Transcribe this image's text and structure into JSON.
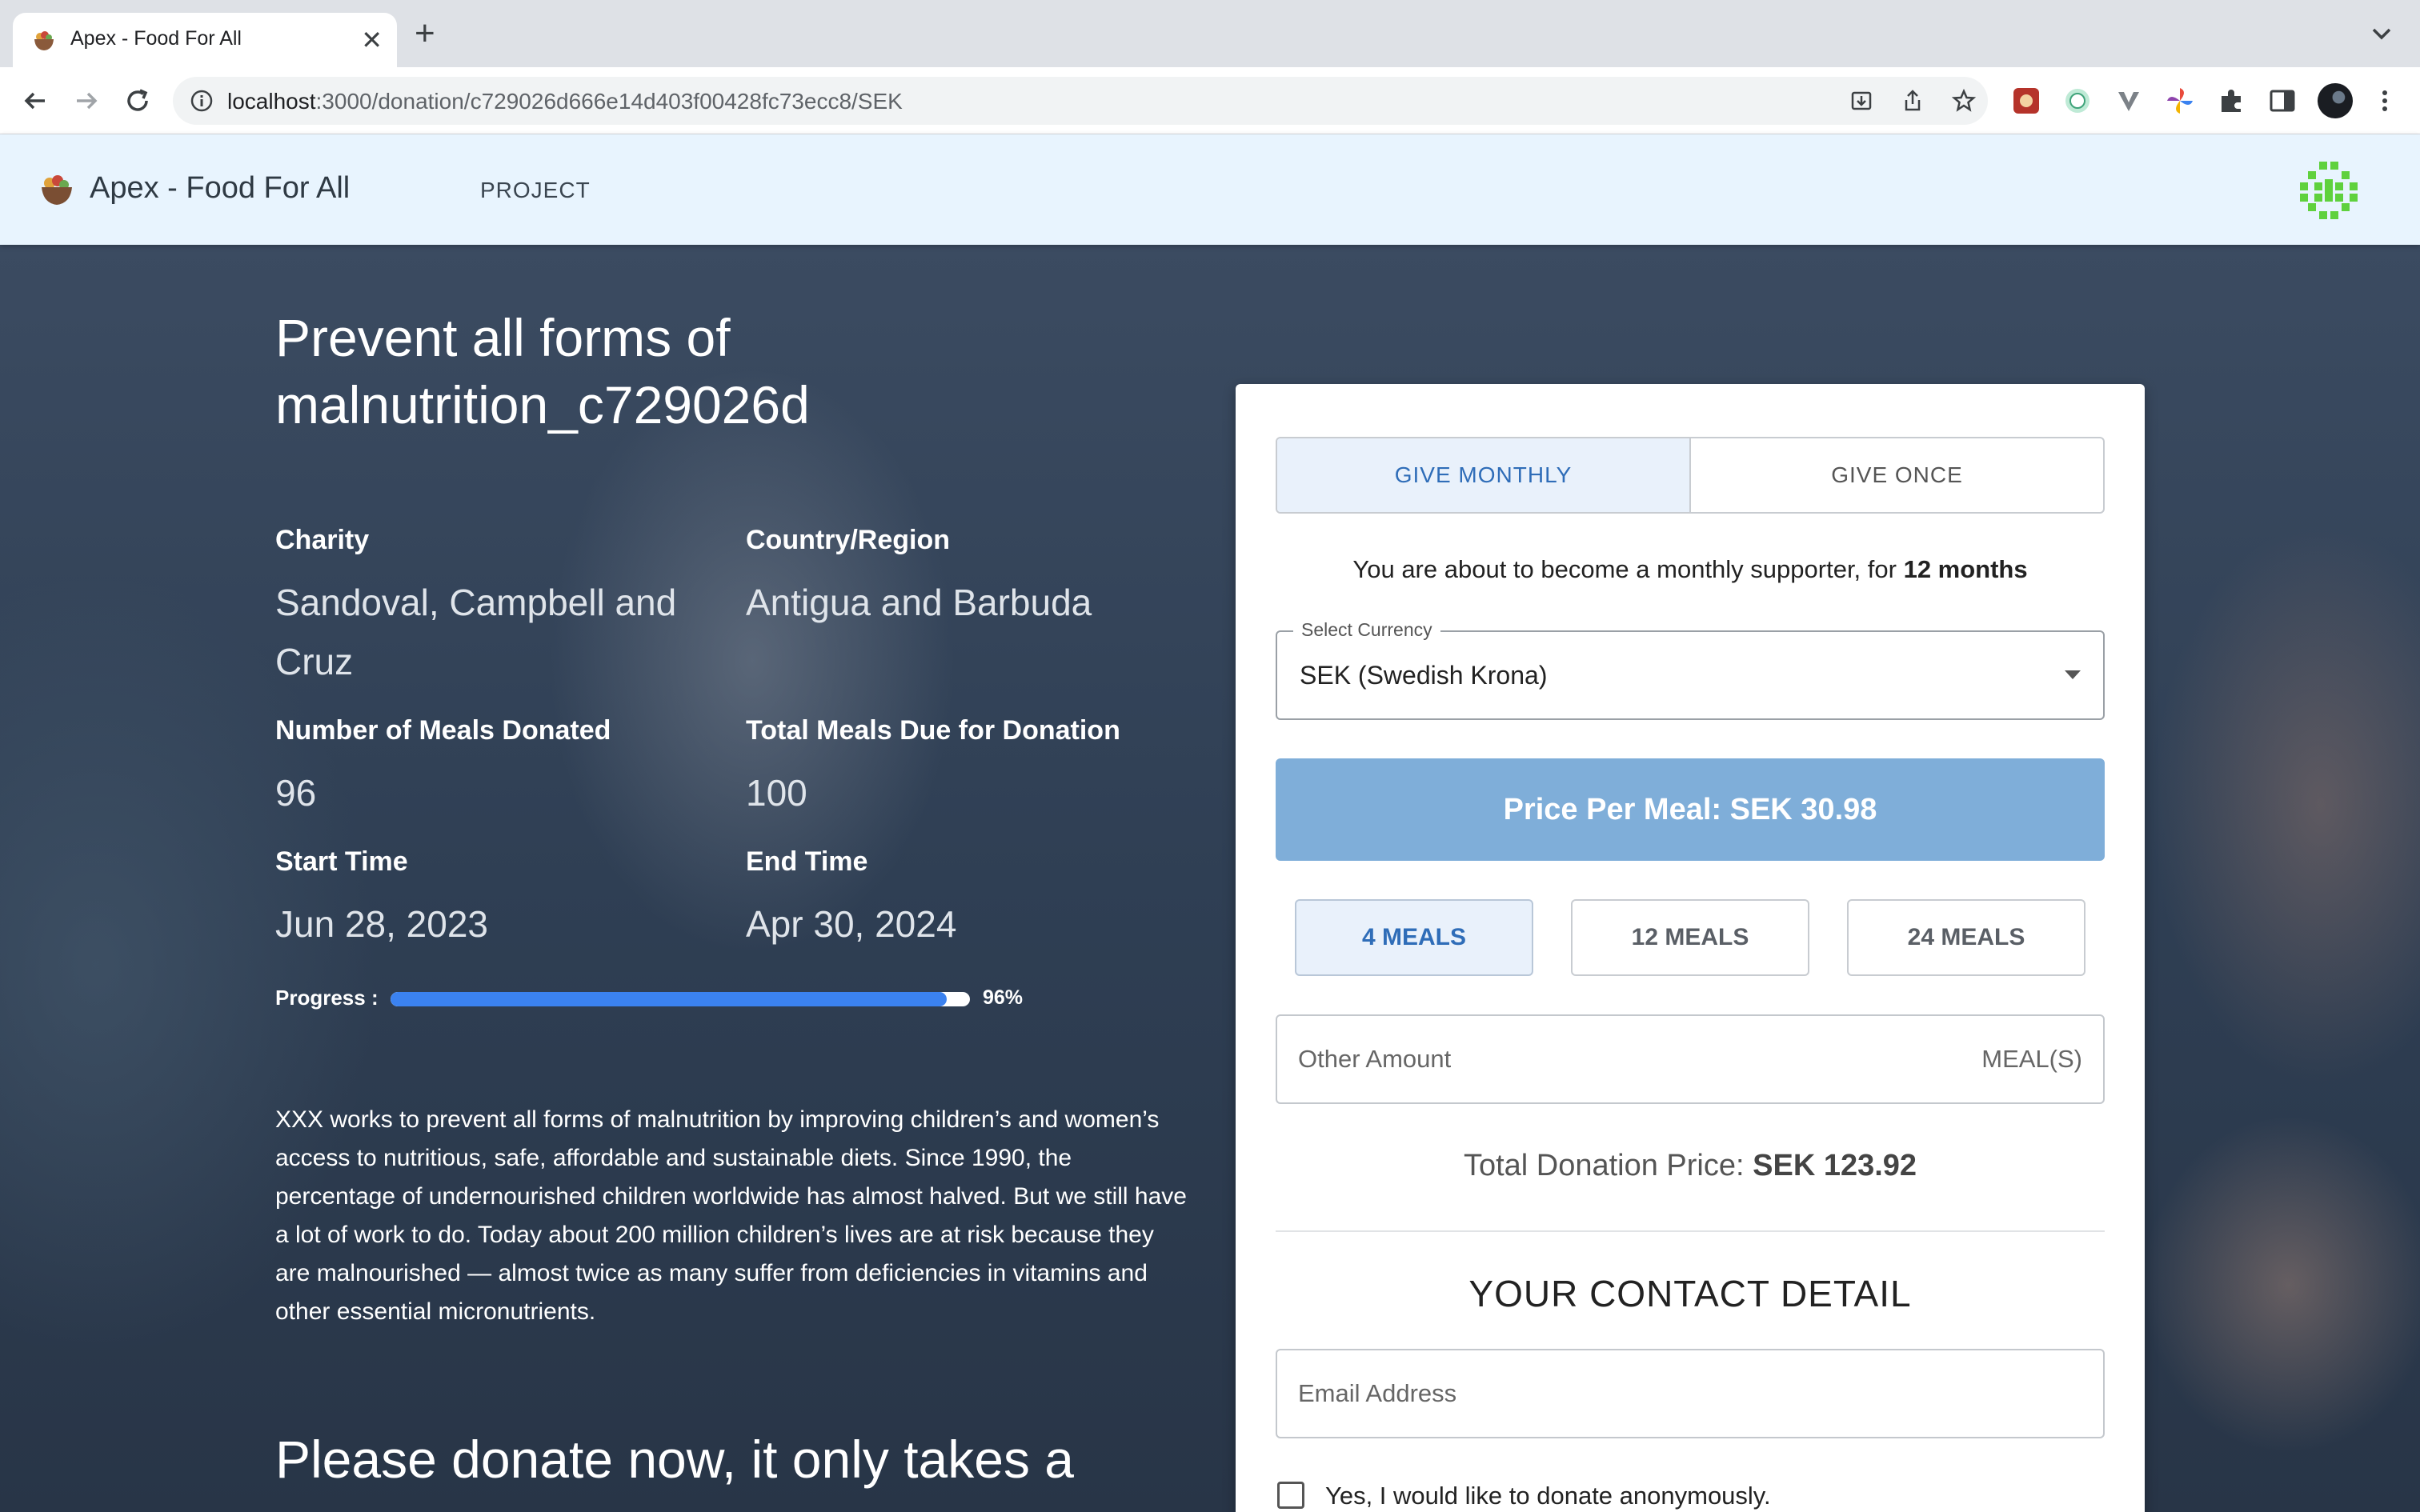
{
  "browser": {
    "tab_title": "Apex - Food For All",
    "url_host": "localhost",
    "url_path": ":3000/donation/c729026d666e14d403f00428fc73ecc8/SEK"
  },
  "header": {
    "app_name": "Apex - Food For All",
    "nav_project": "PROJECT"
  },
  "project": {
    "title": "Prevent all forms of malnutrition_c729026d",
    "charity_label": "Charity",
    "charity_value": "Sandoval, Campbell and Cruz",
    "country_label": "Country/Region",
    "country_value": "Antigua and Barbuda",
    "meals_donated_label": "Number of Meals Donated",
    "meals_donated_value": "96",
    "meals_due_label": "Total Meals Due for Donation",
    "meals_due_value": "100",
    "start_label": "Start Time",
    "start_value": "Jun 28, 2023",
    "end_label": "End Time",
    "end_value": "Apr 30, 2024",
    "progress_label": "Progress :",
    "progress_percent_text": "96%",
    "progress_fraction": 0.96,
    "description": "XXX works to prevent all forms of malnutrition by improving children’s and women’s access to nutritious, safe, affordable and sustainable diets. Since 1990, the percentage of undernourished children worldwide has almost halved. But we still have a lot of work to do. Today about 200 million children’s lives are at risk because they are malnourished — almost twice as many suffer from deficiencies in vitamins and other essential micronutrients.",
    "cta_heading": "Please donate now, it only takes a"
  },
  "donation": {
    "give_monthly": "GIVE MONTHLY",
    "give_once": "GIVE ONCE",
    "supporter_text": "You are about to become a monthly supporter, for ",
    "supporter_duration": "12 months",
    "currency_label": "Select Currency",
    "currency_value": "SEK (Swedish Krona)",
    "price_per_meal": "Price Per Meal: SEK 30.98",
    "meal_options": [
      "4 MEALS",
      "12 MEALS",
      "24 MEALS"
    ],
    "other_amount_placeholder": "Other Amount",
    "other_amount_unit": "MEAL(S)",
    "total_label": "Total Donation Price: ",
    "total_value": "SEK 123.92",
    "contact_heading": "YOUR CONTACT DETAIL",
    "email_placeholder": "Email Address",
    "anonymous_label": "Yes, I would like to donate anonymously."
  },
  "colors": {
    "header_bg": "#e8f4fe",
    "progress_fill": "#3b82f0",
    "price_bar": "#7faed9",
    "active_accent": "#2f6db8"
  }
}
